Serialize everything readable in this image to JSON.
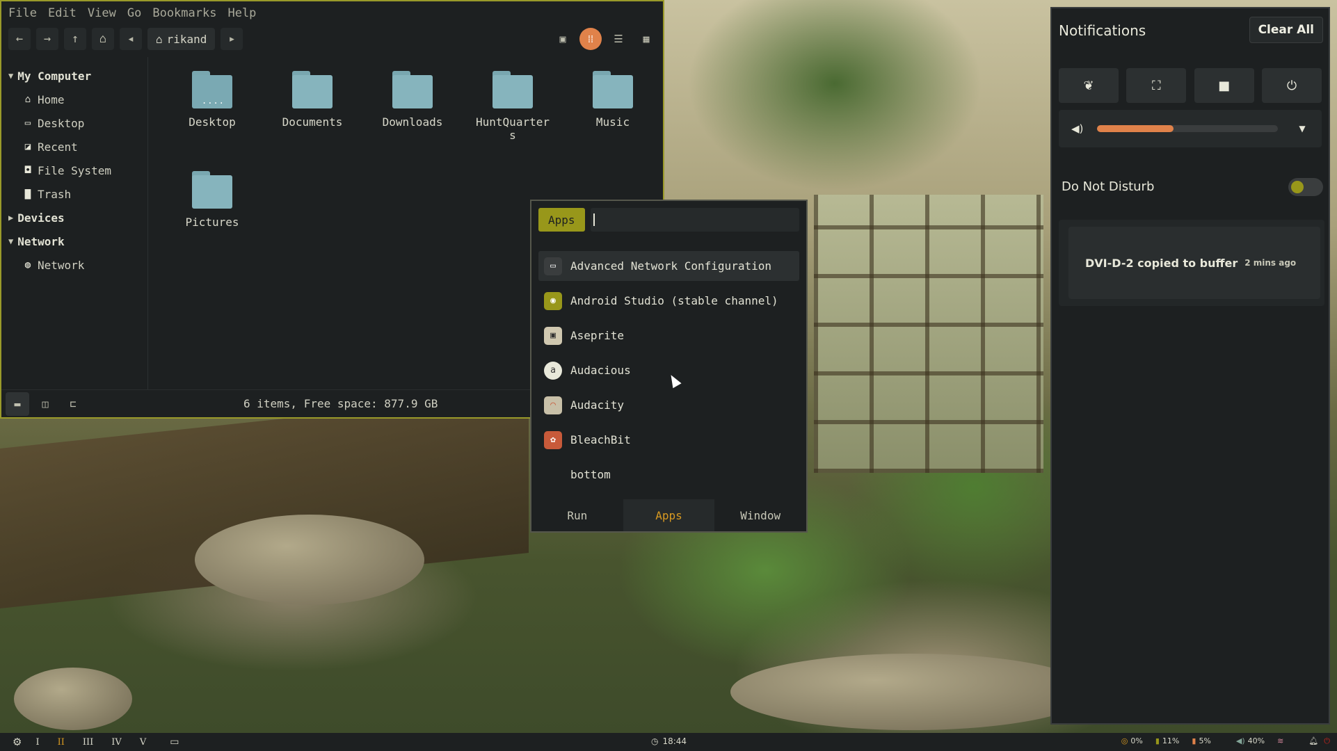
{
  "file_manager": {
    "menu": [
      "File",
      "Edit",
      "View",
      "Go",
      "Bookmarks",
      "Help"
    ],
    "breadcrumb": "rikand",
    "sidebar": {
      "my_computer": "My Computer",
      "items": [
        "Home",
        "Desktop",
        "Recent",
        "File System",
        "Trash"
      ],
      "devices": "Devices",
      "network": "Network",
      "network_items": [
        "Network"
      ]
    },
    "files": [
      "Desktop",
      "Documents",
      "Downloads",
      "HuntQuarters",
      "Music",
      "Pictures"
    ],
    "status": "6 items, Free space: 877.9 GB"
  },
  "launcher": {
    "mode": "Apps",
    "search_value": "",
    "items": [
      {
        "label": "Advanced Network Configuration",
        "icon": "network-config-icon",
        "color": "#3a3d3e"
      },
      {
        "label": "Android Studio (stable channel)",
        "icon": "android-studio-icon",
        "color": "#98971a"
      },
      {
        "label": "Aseprite",
        "icon": "aseprite-icon",
        "color": "#d0c8b0"
      },
      {
        "label": "Audacious",
        "icon": "audacious-icon",
        "color": "#e8e8da"
      },
      {
        "label": "Audacity",
        "icon": "audacity-icon",
        "color": "#c8c0a8"
      },
      {
        "label": "BleachBit",
        "icon": "bleachbit-icon",
        "color": "#c85a3a"
      },
      {
        "label": "bottom",
        "icon": "",
        "color": "transparent"
      }
    ],
    "tabs": [
      "Run",
      "Apps",
      "Window"
    ],
    "active_tab": "Apps"
  },
  "notifications": {
    "title": "Notifications",
    "clear_all": "Clear All",
    "quick_settings": [
      "leaf-icon",
      "screenshot-icon",
      "record-icon",
      "power-icon"
    ],
    "volume_fraction": 0.42,
    "do_not_disturb": "Do Not Disturb",
    "items": [
      {
        "message": "DVI-D-2 copied to buffer",
        "time": "2 mins ago"
      }
    ]
  },
  "taskbar": {
    "workspaces": [
      "I",
      "II",
      "III",
      "IV",
      "V"
    ],
    "active_workspace": "II",
    "clock": "18:44",
    "cpu": "0%",
    "memory": "11%",
    "disk": "5%",
    "volume": "40%"
  },
  "colors": {
    "accent_orange": "#e0824a",
    "accent_yellow": "#98971a",
    "accent_gold": "#d79921",
    "bg_dark": "#1d2021"
  }
}
